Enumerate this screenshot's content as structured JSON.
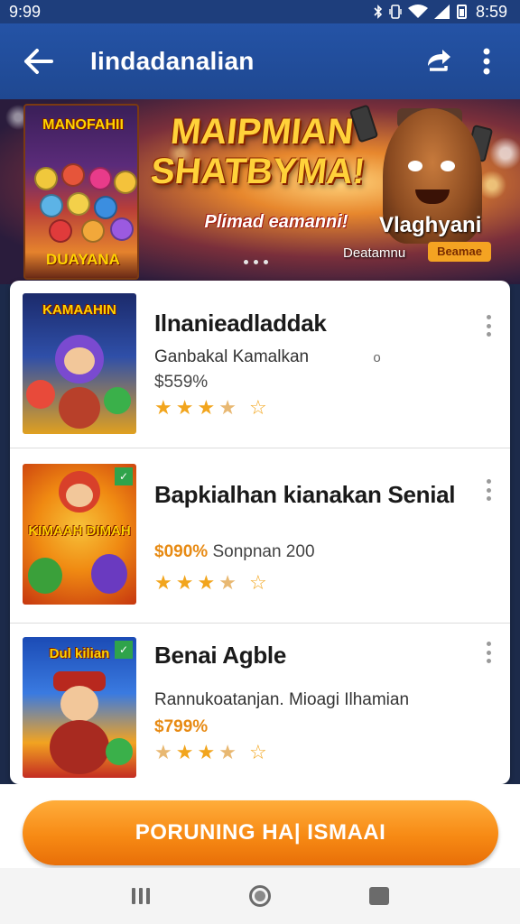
{
  "status_bar": {
    "time": "9:99",
    "clock": "8:59"
  },
  "app_bar": {
    "title": "Iindadanalian",
    "icons": [
      "arrow-left-icon",
      "share-icon",
      "more-vert-icon"
    ]
  },
  "banner": {
    "poster_title": "MANOFAHII",
    "poster_subtitle": "DUAYANA",
    "headline": "MAIPMIAN SHATBYMA!",
    "tagline": "Plimad eamanni!",
    "name": "Vlaghyani",
    "caption": "Deatamnu",
    "badge": "Beamae",
    "slide_count": 3
  },
  "list": {
    "items": [
      {
        "title": "Ilnanieadladdak",
        "subtitle": "Ganbakal Kamalkan",
        "subtitle_extra": "o",
        "price": "$559%",
        "price_extra": "",
        "rating": 3.5,
        "thumb_title": "KAMAAHIN",
        "thumb_colors": [
          "#1b2a6b",
          "#3b5bb5",
          "#e0a020"
        ]
      },
      {
        "title": "Bapkialhan kianakan Senial",
        "subtitle": "",
        "subtitle_extra": "",
        "price": "$090%",
        "price_extra": "Sonpnan 200",
        "rating": 3.5,
        "thumb_title": "KIMAAH DIMAH",
        "thumb_colors": [
          "#f08a12",
          "#f7c23a",
          "#c6360f"
        ]
      },
      {
        "title": "Benai Agble",
        "subtitle": "Rannukoatanjan. Mioagi Ilhamian",
        "subtitle_extra": "",
        "price": "$799%",
        "price_extra": "",
        "rating": 3.5,
        "thumb_title": "Dul kilian",
        "thumb_colors": [
          "#1b4bb5",
          "#f2a321",
          "#c42c22"
        ]
      }
    ]
  },
  "cta": {
    "label": "PORUNING HA| ISMAAI"
  },
  "nav_bar": {
    "icons": [
      "recents-icon",
      "home-icon",
      "back-icon"
    ]
  },
  "colors": {
    "app_bar": "#2453a6",
    "status_bar": "#1e3e7c",
    "accent_orange": "#f78a14",
    "star": "#f2a51d"
  }
}
